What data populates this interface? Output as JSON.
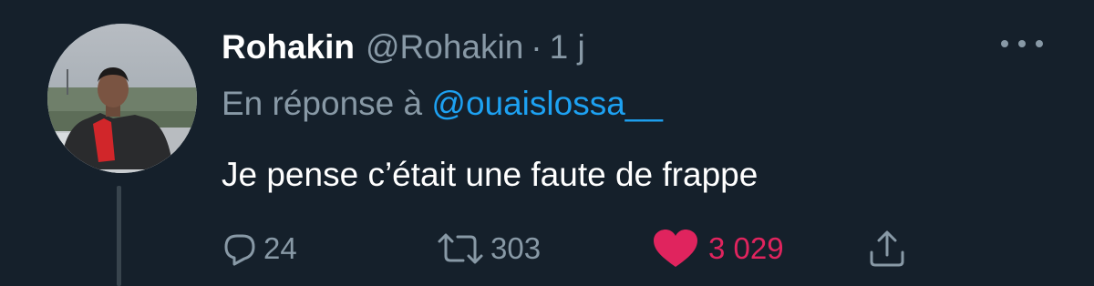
{
  "tweet": {
    "display_name": "Rohakin",
    "handle": "@Rohakin",
    "separator": "·",
    "time": "1 j",
    "reply_prefix": "En réponse à",
    "reply_to": "@ouaislossa__",
    "text": "Je pense c’était une faute de frappe",
    "reply_count": "24",
    "retweet_count": "303",
    "like_count": "3 029",
    "liked": true
  },
  "icons": {
    "reply": "reply-icon",
    "retweet": "retweet-icon",
    "like": "heart-icon",
    "share": "share-icon",
    "more": "more-icon"
  },
  "colors": {
    "background": "#15202b",
    "secondary_text": "#8899a6",
    "mention": "#1da1f2",
    "like": "#e0245e"
  }
}
